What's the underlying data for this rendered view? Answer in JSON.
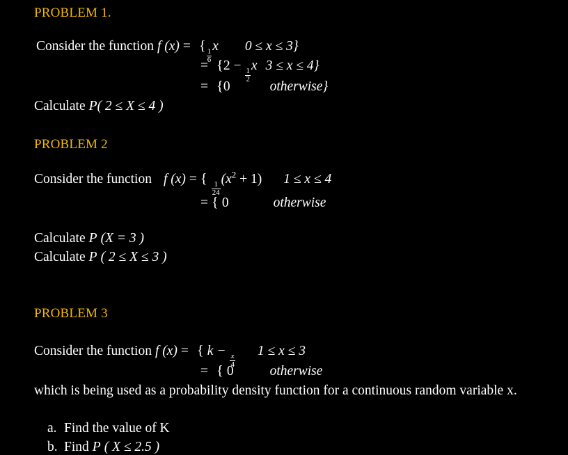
{
  "document": {
    "background_color": "#000000",
    "text_color": "#ffffff",
    "heading_color": "#f5b800"
  },
  "problem1": {
    "heading": "PROBLEM 1.",
    "consider_label": "Consider the function",
    "fx": "f (x)",
    "eq": "=",
    "case1_open": "{",
    "case1_frac_num": "1",
    "case1_frac_den": "6",
    "case1_var": "x",
    "case1_range": "0 ≤ x ≤ 3}",
    "case2_open": "{",
    "case2_lead": "2 −",
    "case2_frac_num": "1",
    "case2_frac_den": "2",
    "case2_var": "x",
    "case2_range": "3 ≤ x ≤ 4}",
    "case3_open": "{",
    "case3_value": "0",
    "case3_range": "otherwise}",
    "calculate": "Calculate",
    "calculate_p": "P",
    "calculate_expr": "( 2 ≤ X ≤ 4 )"
  },
  "problem2": {
    "heading": "PROBLEM 2",
    "consider_label": "Consider the function",
    "fx": "f (x)",
    "eq": "=",
    "case1_open": "{",
    "case1_frac_num": "1",
    "case1_frac_den": "24",
    "case1_body_open": "(x",
    "case1_body_sup": "2",
    "case1_body_close": " + 1)",
    "case1_range": "1 ≤ x ≤ 4",
    "case2_open": "{",
    "case2_value": "0",
    "case2_range": "otherwise",
    "calc1_label": "Calculate",
    "calc1_p": "P",
    "calc1_expr": "(X = 3 )",
    "calc2_label": "Calculate",
    "calc2_p": "P",
    "calc2_expr": "( 2 ≤ X ≤ 3 )"
  },
  "problem3": {
    "heading": "PROBLEM 3",
    "consider_label": "Consider the function",
    "fx": "f (x)",
    "eq": "=",
    "case1_open": "{",
    "case1_lead": "k −",
    "case1_frac_num": "x",
    "case1_frac_den": "4",
    "case1_range": "1 ≤ x ≤ 3",
    "case2_open": "{",
    "case2_value": "0",
    "case2_range": "otherwise",
    "description": "which is being used as a probability density function for a continuous random variable x.",
    "items": [
      {
        "label": "a.",
        "text": "Find the value of K",
        "p": "",
        "expr": ""
      },
      {
        "label": "b.",
        "text": "Find",
        "p": "P",
        "expr": "( X ≤ 2.5 )"
      }
    ]
  }
}
